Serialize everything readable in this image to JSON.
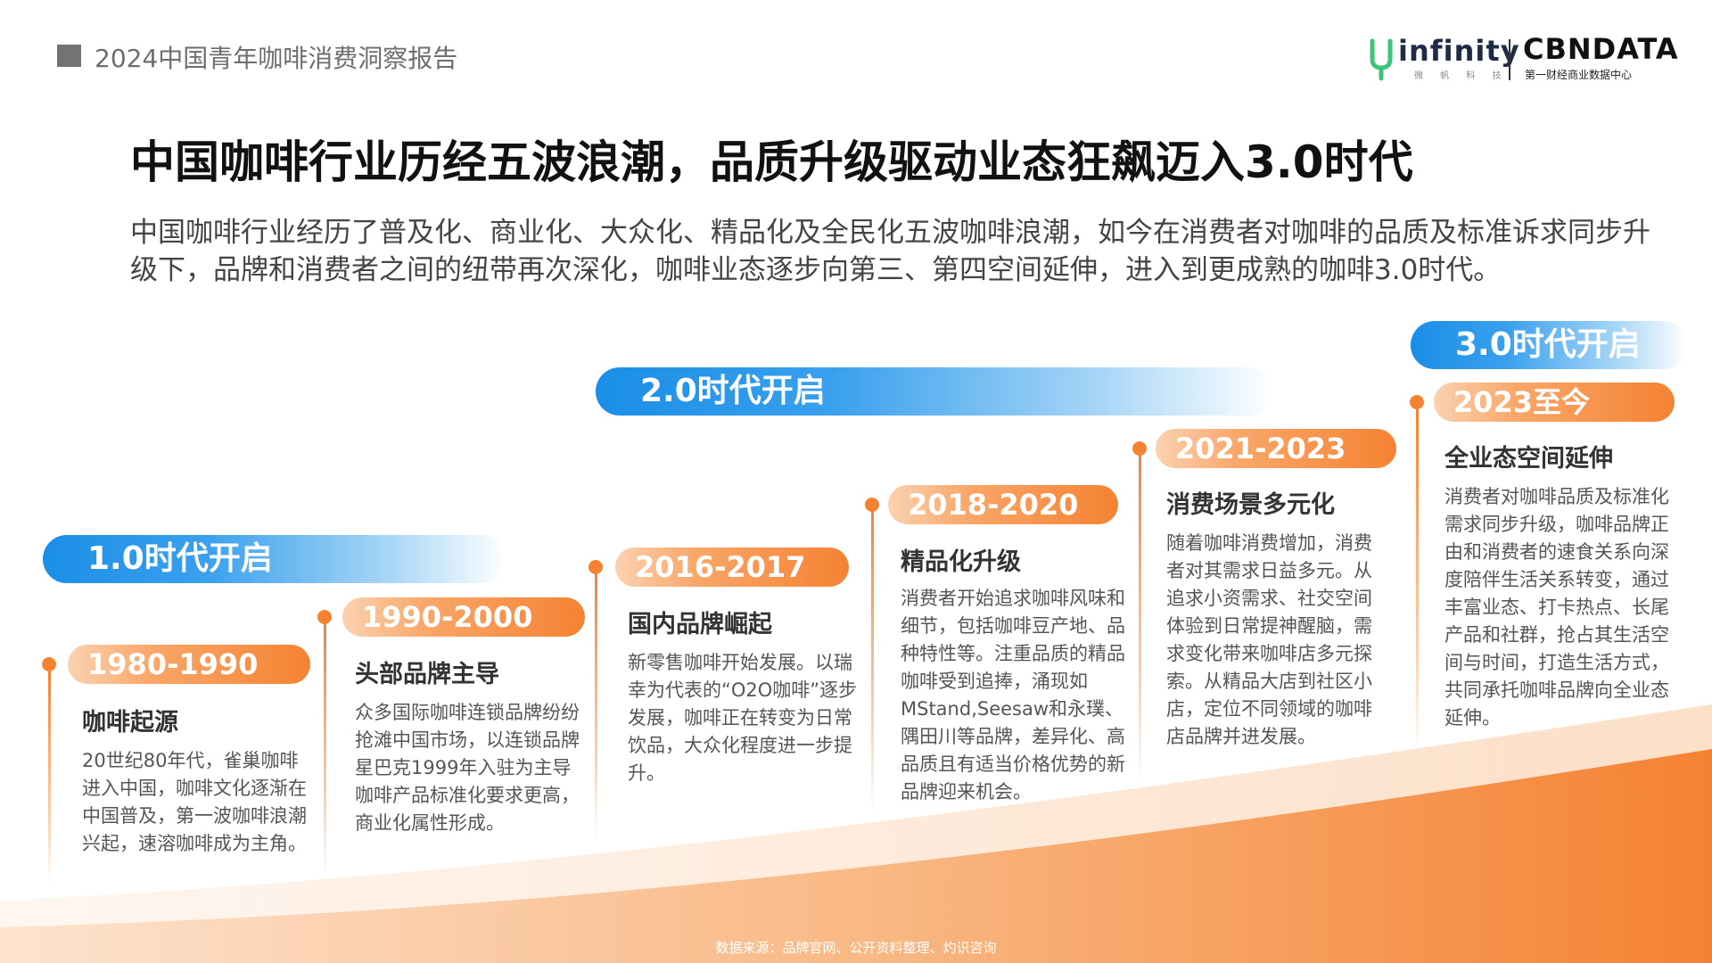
{
  "header": {
    "report_title": "2024中国青年咖啡消费洞察报告",
    "logo_infinity": "infinity",
    "logo_infinity_sub": "微 帆 科 技",
    "logo_cbn": "CBNDATA",
    "logo_cbn_sub": "第一财经商业数据中心"
  },
  "title": "中国咖啡行业历经五波浪潮，品质升级驱动业态狂飙迈入3.0时代",
  "intro": "中国咖啡行业经历了普及化、商业化、大众化、精品化及全民化五波咖啡浪潮，如今在消费者对咖啡的品质及标准诉求同步升级下，品牌和消费者之间的纽带再次深化，咖啡业态逐步向第三、第四空间延伸，进入到更成熟的咖啡3.0时代。",
  "eras": [
    "1.0时代开启",
    "2.0时代开启",
    "3.0时代开启"
  ],
  "stages": [
    {
      "years": "1980-1990",
      "heading": "咖啡起源",
      "body": "20世纪80年代，雀巢咖啡进入中国，咖啡文化逐渐在中国普及，第一波咖啡浪潮兴起，速溶咖啡成为主角。"
    },
    {
      "years": "1990-2000",
      "heading": "头部品牌主导",
      "body": "众多国际咖啡连锁品牌纷纷抢滩中国市场，以连锁品牌星巴克1999年入驻为主导咖啡产品标准化要求更高，商业化属性形成。"
    },
    {
      "years": "2016-2017",
      "heading": "国内品牌崛起",
      "body": "新零售咖啡开始发展。以瑞幸为代表的“O2O咖啡”逐步发展，咖啡正在转变为日常饮品，大众化程度进一步提升。"
    },
    {
      "years": "2018-2020",
      "heading": "精品化升级",
      "body": "消费者开始追求咖啡风味和细节，包括咖啡豆产地、品种特性等。注重品质的精品咖啡受到追捧，涌现如MStand,Seesaw和永璞、隅田川等品牌，差异化、高品质且有适当价格优势的新品牌迎来机会。"
    },
    {
      "years": "2021-2023",
      "heading": "消费场景多元化",
      "body": "随着咖啡消费增加，消费者对其需求日益多元。从追求小资需求、社交空间体验到日常提神醒脑，需求变化带来咖啡店多元探索。从精品大店到社区小店，定位不同领域的咖啡店品牌并进发展。"
    },
    {
      "years": "2023至今",
      "heading": "全业态空间延伸",
      "body": "消费者对咖啡品质及标准化需求同步升级，咖啡品牌正由和消费者的速食关系向深度陪伴生活关系转变，通过丰富业态、打卡热点、长尾产品和社群，抢占其生活空间与时间，打造生活方式，共同承托咖啡品牌向全业态延伸。"
    }
  ],
  "source": "数据来源：品牌官网、公开资料整理、灼识咨询",
  "colors": {
    "orange": "#f58232",
    "blue": "#1a8ee6",
    "header_gray": "#737373"
  }
}
